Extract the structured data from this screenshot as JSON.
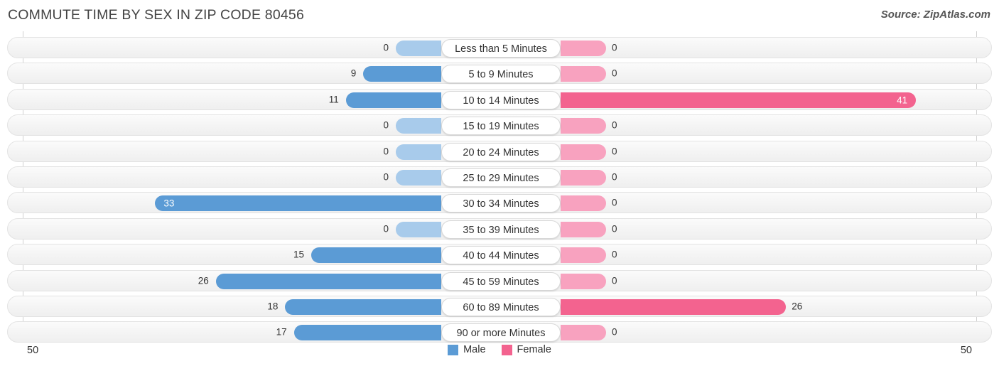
{
  "header": {
    "title": "COMMUTE TIME BY SEX IN ZIP CODE 80456",
    "source": "Source: ZipAtlas.com"
  },
  "legend": {
    "male_label": "Male",
    "female_label": "Female",
    "male_color": "#5b9bd5",
    "female_color": "#f3638f"
  },
  "axis": {
    "left_tick": "50",
    "right_tick": "50"
  },
  "chart_data": {
    "type": "bar",
    "title": "COMMUTE TIME BY SEX IN ZIP CODE 80456",
    "orientation": "horizontal-diverging",
    "xlabel": "",
    "ylabel": "",
    "xlim": [
      50,
      50
    ],
    "grid": false,
    "legend_position": "bottom-center",
    "categories": [
      "Less than 5 Minutes",
      "5 to 9 Minutes",
      "10 to 14 Minutes",
      "15 to 19 Minutes",
      "20 to 24 Minutes",
      "25 to 29 Minutes",
      "30 to 34 Minutes",
      "35 to 39 Minutes",
      "40 to 44 Minutes",
      "45 to 59 Minutes",
      "60 to 89 Minutes",
      "90 or more Minutes"
    ],
    "series": [
      {
        "name": "Male",
        "color": "#5b9bd5",
        "values": [
          0,
          9,
          11,
          0,
          0,
          0,
          33,
          0,
          15,
          26,
          18,
          17
        ]
      },
      {
        "name": "Female",
        "color": "#f3638f",
        "values": [
          0,
          0,
          41,
          0,
          0,
          0,
          0,
          0,
          0,
          0,
          26,
          0
        ]
      }
    ],
    "rows": [
      {
        "category": "Less than 5 Minutes",
        "male": 0,
        "female": 0
      },
      {
        "category": "5 to 9 Minutes",
        "male": 9,
        "female": 0
      },
      {
        "category": "10 to 14 Minutes",
        "male": 11,
        "female": 41
      },
      {
        "category": "15 to 19 Minutes",
        "male": 0,
        "female": 0
      },
      {
        "category": "20 to 24 Minutes",
        "male": 0,
        "female": 0
      },
      {
        "category": "25 to 29 Minutes",
        "male": 0,
        "female": 0
      },
      {
        "category": "30 to 34 Minutes",
        "male": 33,
        "female": 0
      },
      {
        "category": "35 to 39 Minutes",
        "male": 0,
        "female": 0
      },
      {
        "category": "40 to 44 Minutes",
        "male": 15,
        "female": 0
      },
      {
        "category": "45 to 59 Minutes",
        "male": 26,
        "female": 0
      },
      {
        "category": "60 to 89 Minutes",
        "male": 18,
        "female": 26
      },
      {
        "category": "90 or more Minutes",
        "male": 17,
        "female": 0
      }
    ]
  }
}
